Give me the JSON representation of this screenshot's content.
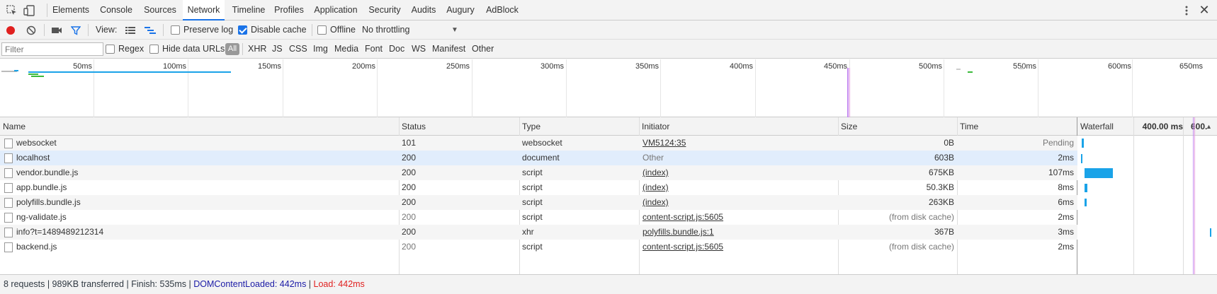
{
  "tabs": [
    {
      "label": "Elements",
      "active": false
    },
    {
      "label": "Console",
      "active": false
    },
    {
      "label": "Sources",
      "active": false
    },
    {
      "label": "Network",
      "active": true
    },
    {
      "label": "Timeline",
      "active": false
    },
    {
      "label": "Profiles",
      "active": false
    },
    {
      "label": "Application",
      "active": false
    },
    {
      "label": "Security",
      "active": false
    },
    {
      "label": "Audits",
      "active": false
    },
    {
      "label": "Augury",
      "active": false
    },
    {
      "label": "AdBlock",
      "active": false
    }
  ],
  "toolbar": {
    "view_label": "View:",
    "preserve_log": {
      "label": "Preserve log",
      "checked": false
    },
    "disable_cache": {
      "label": "Disable cache",
      "checked": true
    },
    "offline": {
      "label": "Offline",
      "checked": false
    },
    "throttling": "No throttling",
    "record_color": "#e0201f"
  },
  "filterbar": {
    "placeholder": "Filter",
    "regex": "Regex",
    "hide_data_urls": "Hide data URLs",
    "all": "All",
    "types": [
      "XHR",
      "JS",
      "CSS",
      "Img",
      "Media",
      "Font",
      "Doc",
      "WS",
      "Manifest",
      "Other"
    ]
  },
  "overview": {
    "ticks": [
      "50ms",
      "100ms",
      "150ms",
      "200ms",
      "250ms",
      "300ms",
      "350ms",
      "400ms",
      "450ms",
      "500ms",
      "550ms",
      "600ms",
      "650ms"
    ]
  },
  "table": {
    "headers": {
      "name": "Name",
      "status": "Status",
      "type": "Type",
      "initiator": "Initiator",
      "size": "Size",
      "time": "Time",
      "waterfall": "Waterfall",
      "wf_tick1": "400.00 ms",
      "wf_tick2": "600."
    },
    "rows": [
      {
        "name": "websocket",
        "status": "101",
        "type": "websocket",
        "initiator": "VM5124:35",
        "size": "0B",
        "time": "Pending"
      },
      {
        "name": "localhost",
        "status": "200",
        "type": "document",
        "initiator": "Other",
        "size": "603B",
        "time": "2ms"
      },
      {
        "name": "vendor.bundle.js",
        "status": "200",
        "type": "script",
        "initiator": "(index)",
        "size": "675KB",
        "time": "107ms"
      },
      {
        "name": "app.bundle.js",
        "status": "200",
        "type": "script",
        "initiator": "(index)",
        "size": "50.3KB",
        "time": "8ms"
      },
      {
        "name": "polyfills.bundle.js",
        "status": "200",
        "type": "script",
        "initiator": "(index)",
        "size": "263KB",
        "time": "6ms"
      },
      {
        "name": "ng-validate.js",
        "status": "200",
        "type": "script",
        "initiator": "content-script.js:5605",
        "size": "(from disk cache)",
        "time": "2ms"
      },
      {
        "name": "info?t=1489489212314",
        "status": "200",
        "type": "xhr",
        "initiator": "polyfills.bundle.js:1",
        "size": "367B",
        "time": "3ms"
      },
      {
        "name": "backend.js",
        "status": "200",
        "type": "script",
        "initiator": "content-script.js:5605",
        "size": "(from disk cache)",
        "time": "2ms"
      }
    ]
  },
  "status": {
    "summary": "8 requests | 989KB transferred | Finish: 535ms | ",
    "dcl": "DOMContentLoaded: 442ms",
    "sep": " | ",
    "load": "Load: 442ms",
    "dcl_color": "#1a1aa6",
    "load_color": "#e0201f"
  }
}
